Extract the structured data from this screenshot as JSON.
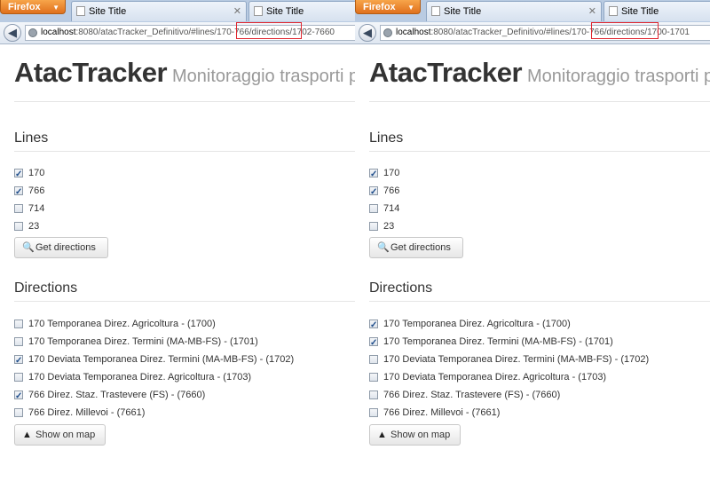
{
  "panes": [
    {
      "browser": {
        "app_button": "Firefox",
        "tabs": [
          {
            "title": "Site Title"
          },
          {
            "title": "Site Title"
          }
        ],
        "url_host": "localhost",
        "url_rest": ":8080/atacTracker_Definitivo/#lines/170-766/directions/",
        "url_highlight": "1702-7660"
      },
      "page": {
        "brand": "AtacTracker",
        "tagline": "Monitoraggio trasporti p",
        "lines_heading": "Lines",
        "lines": [
          {
            "label": "170",
            "checked": true
          },
          {
            "label": "766",
            "checked": true
          },
          {
            "label": "714",
            "checked": false
          },
          {
            "label": "23",
            "checked": false
          }
        ],
        "get_directions_label": "Get directions",
        "directions_heading": "Directions",
        "directions": [
          {
            "label": "170 Temporanea Direz. Agricoltura - (1700)",
            "checked": false
          },
          {
            "label": "170 Temporanea Direz. Termini (MA-MB-FS) - (1701)",
            "checked": false
          },
          {
            "label": "170 Deviata Temporanea Direz. Termini (MA-MB-FS) - (1702)",
            "checked": true
          },
          {
            "label": "170 Deviata Temporanea Direz. Agricoltura - (1703)",
            "checked": false
          },
          {
            "label": "766 Direz. Staz. Trastevere (FS) - (7660)",
            "checked": true
          },
          {
            "label": "766 Direz. Millevoi - (7661)",
            "checked": false
          }
        ],
        "show_on_map_label": "Show on map"
      }
    },
    {
      "browser": {
        "app_button": "Firefox",
        "tabs": [
          {
            "title": "Site Title"
          },
          {
            "title": "Site Title"
          }
        ],
        "url_host": "localhost",
        "url_rest": ":8080/atacTracker_Definitivo/#lines/170-766/directions/",
        "url_highlight": "1700-1701"
      },
      "page": {
        "brand": "AtacTracker",
        "tagline": "Monitoraggio trasporti p",
        "lines_heading": "Lines",
        "lines": [
          {
            "label": "170",
            "checked": true
          },
          {
            "label": "766",
            "checked": true
          },
          {
            "label": "714",
            "checked": false
          },
          {
            "label": "23",
            "checked": false
          }
        ],
        "get_directions_label": "Get directions",
        "directions_heading": "Directions",
        "directions": [
          {
            "label": "170 Temporanea Direz. Agricoltura - (1700)",
            "checked": true
          },
          {
            "label": "170 Temporanea Direz. Termini (MA-MB-FS) - (1701)",
            "checked": true
          },
          {
            "label": "170 Deviata Temporanea Direz. Termini (MA-MB-FS) - (1702)",
            "checked": false
          },
          {
            "label": "170 Deviata Temporanea Direz. Agricoltura - (1703)",
            "checked": false
          },
          {
            "label": "766 Direz. Staz. Trastevere (FS) - (7660)",
            "checked": false
          },
          {
            "label": "766 Direz. Millevoi - (7661)",
            "checked": false
          }
        ],
        "show_on_map_label": "Show on map"
      }
    }
  ],
  "icons": {
    "search": "search-icon",
    "road": "road-icon",
    "back": "back-arrow-icon",
    "globe": "site-identity-icon"
  },
  "colors": {
    "url_highlight_border": "#e0262f",
    "firefox_button": "#e0701c"
  }
}
